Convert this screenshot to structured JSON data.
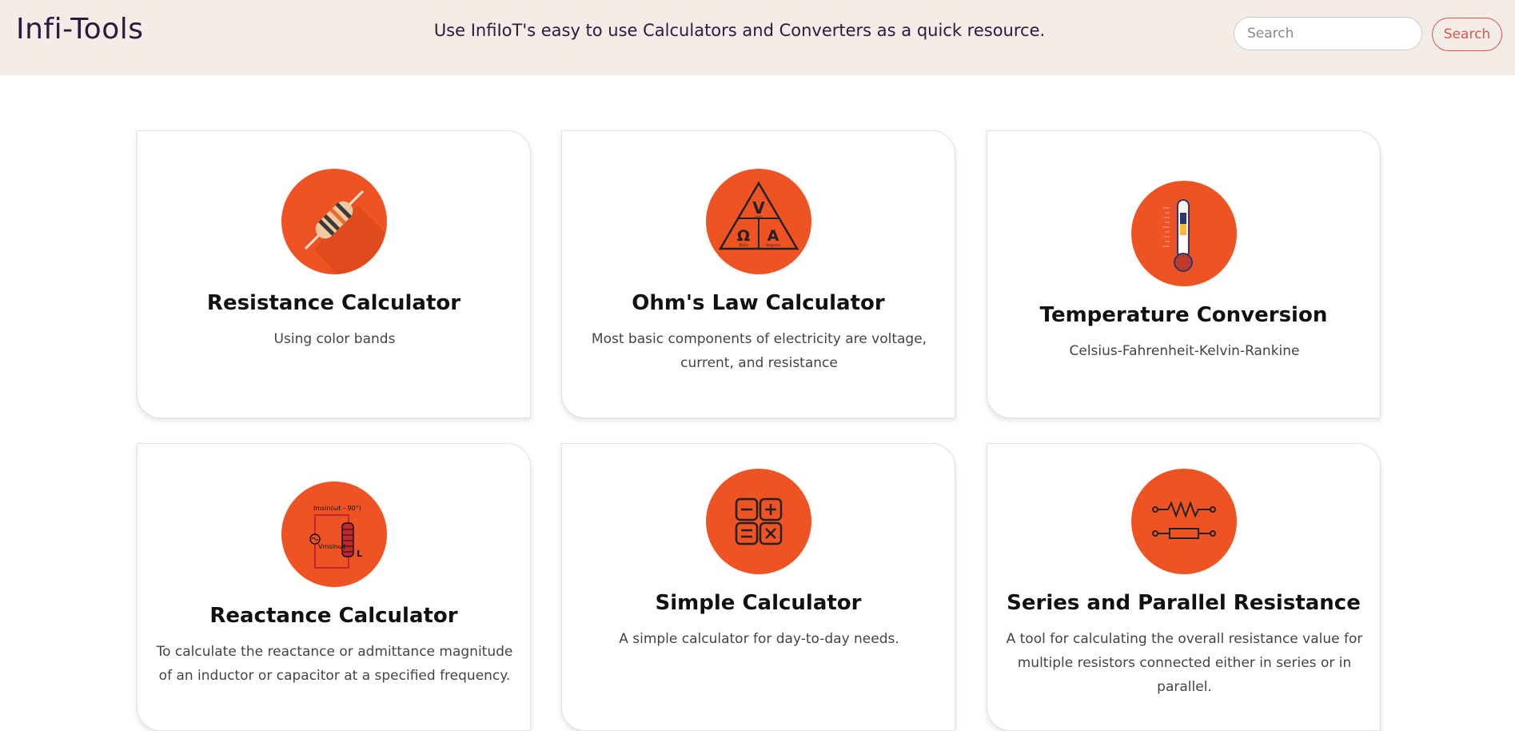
{
  "navbar": {
    "brand": "Infi-Tools",
    "tagline": "Use InfiIoT's easy to use Calculators and Converters as a quick resource.",
    "search_placeholder": "Search",
    "search_button": "Search"
  },
  "cards": [
    {
      "title": "Resistance Calculator",
      "description": "Using color bands",
      "icon": "resistor-icon"
    },
    {
      "title": "Ohm's Law Calculator",
      "description": "Most basic components of electricity are voltage, current, and resistance",
      "icon": "ohms-law-triangle-icon"
    },
    {
      "title": "Temperature Conversion",
      "description": "Celsius-Fahrenheit-Kelvin-Rankine",
      "icon": "thermometer-icon"
    },
    {
      "title": "Reactance Calculator",
      "description": "To calculate the reactance or admittance magnitude of an inductor or capacitor at a specified frequency.",
      "icon": "inductor-circuit-icon"
    },
    {
      "title": "Simple Calculator",
      "description": "A simple calculator for day-to-day needs.",
      "icon": "calculator-icon"
    },
    {
      "title": "Series and Parallel Resistance",
      "description": "A tool for calculating the overall resistance value for multiple resistors connected either in series or in parallel.",
      "icon": "resistor-network-icon"
    }
  ],
  "icon_text": {
    "ohm_v": "V",
    "ohm_omega": "Ω",
    "ohm_a": "A",
    "ohm_volts": "Volts",
    "ohm_ohms": "Ohms",
    "ohm_amperes": "Amperes",
    "react_top": "Imsin(ωt - 90°)",
    "react_left": "Vmsinωt",
    "react_l": "L"
  },
  "colors": {
    "accent": "#f05323",
    "navbar_bg": "#f4ece7",
    "search_button": "#d9534f",
    "brand_text": "#2a1b3d"
  }
}
